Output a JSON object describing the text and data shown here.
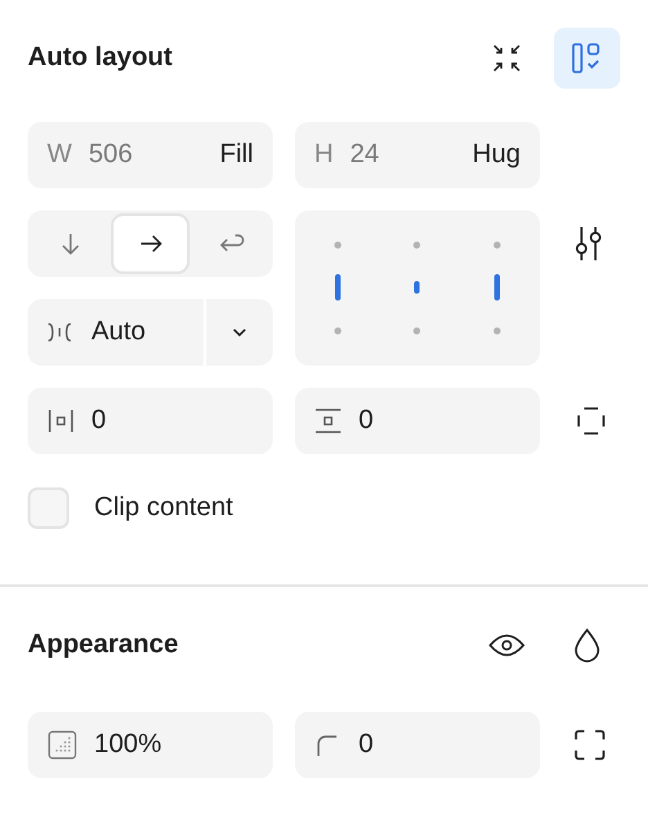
{
  "auto_layout": {
    "title": "Auto layout",
    "layout_suggest_selected": true,
    "width": {
      "label": "W",
      "value": "506",
      "mode": "Fill"
    },
    "height": {
      "label": "H",
      "value": "24",
      "mode": "Hug"
    },
    "direction": [
      {
        "kind": "down",
        "selected": false
      },
      {
        "kind": "right",
        "selected": true
      },
      {
        "kind": "wrap",
        "selected": false
      }
    ],
    "gap": {
      "value": "Auto"
    },
    "padding_horizontal": {
      "value": "0"
    },
    "padding_vertical": {
      "value": "0"
    },
    "clip_content": {
      "label": "Clip content",
      "checked": false
    }
  },
  "appearance": {
    "title": "Appearance",
    "opacity": "100%",
    "radius": "0"
  }
}
